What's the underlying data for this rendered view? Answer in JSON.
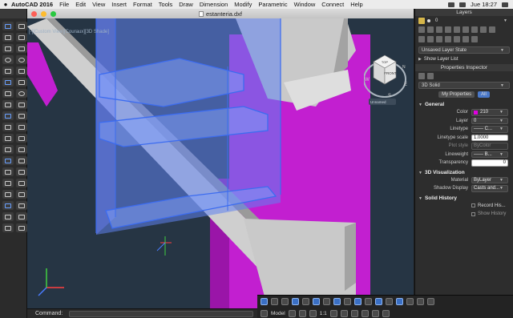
{
  "menubar": {
    "app": "AutoCAD 2016",
    "items": [
      "File",
      "Edit",
      "View",
      "Insert",
      "Format",
      "Tools",
      "Draw",
      "Dimension",
      "Modify",
      "Parametric",
      "Window",
      "Connect",
      "Help"
    ],
    "clock": "Jue 18:27"
  },
  "document": {
    "title": "estanteria.dxf",
    "viewport_label": "[-][Custom View][Couraux][3D Shade]",
    "viewcube": {
      "top": "TOP",
      "front": "FRONT",
      "north": "N",
      "south": "S",
      "west": "W",
      "east": "E",
      "unnamed": "Unnamed"
    }
  },
  "command": {
    "label": "Command:",
    "placeholder": ""
  },
  "layers": {
    "title": "Layers",
    "current_layer": "0",
    "state": "Unsaved Layer State",
    "show_list": "Show Layer List"
  },
  "properties": {
    "title": "Properties Inspector",
    "object_type": "3D Solid",
    "tab_my": "My Properties",
    "tab_all": "All",
    "general_title": "General",
    "color_label": "Color",
    "color_value": "210",
    "color_hex": "#e000e0",
    "layer_label": "Layer",
    "layer_value": "0",
    "linetype_label": "Linetype",
    "linetype_value": "—— C...",
    "linetype_scale_label": "Linetype scale",
    "linetype_scale_value": "1.0000",
    "plot_style_label": "Plot style",
    "plot_style_value": "ByColor",
    "lineweight_label": "Lineweight",
    "lineweight_value": "—— B...",
    "transparency_label": "Transparency",
    "transparency_value": "0",
    "viz_title": "3D Visualization",
    "material_label": "Material",
    "material_value": "ByLayer",
    "shadow_label": "Shadow Display",
    "shadow_value": "Casts and...",
    "history_title": "Solid History",
    "record_label": "Record His...",
    "show_history_label": "Show History"
  },
  "statusbar": {
    "model": "Model",
    "scale": "1:1"
  }
}
